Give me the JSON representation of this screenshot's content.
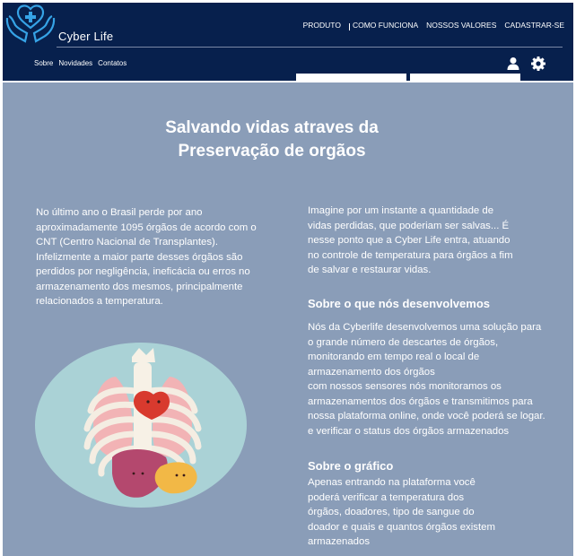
{
  "header": {
    "brand": "Cyber Life",
    "top_nav": [
      "PRODUTO",
      "COMO FUNCIONA",
      "NOSSOS VALORES",
      "CADASTRAR-SE"
    ],
    "sub_nav": [
      "Sobre",
      "Novidades",
      "Contatos"
    ],
    "icons": [
      "user-icon",
      "gear-icon"
    ]
  },
  "main": {
    "title_line1": "Salvando vidas atraves da",
    "title_line2": "Preservação de orgãos",
    "intro": [
      "No último ano o Brasil perde por ano",
      "aproximadamente 1095 órgãos de acordo com o",
      "CNT (Centro Nacional de Transplantes).",
      "Infelizmente a maior parte desses órgãos são",
      "perdidos por negligência, ineficácia ou erros no",
      "armazenamento dos mesmos, principalmente",
      "relacionados a temperatura."
    ],
    "imagine": [
      "Imagine por um instante a quantidade de",
      "vidas perdidas, que poderiam ser salvas... É",
      "nesse ponto que a Cyber Life entra, atuando",
      "no controle de temperatura para órgãos a fim",
      "de salvar e restaurar vidas."
    ],
    "section1_heading": "Sobre o que nós desenvolvemos",
    "section1_text": [
      "Nós da Cyberlife desenvolvemos uma solução para",
      "o grande número de descartes de órgãos,",
      "monitorando em tempo real o local de",
      "armazenamento dos órgãos",
      "com nossos sensores nós monitoramos os",
      "armazenamentos dos órgãos e transmitimos para",
      "nossa plataforma online, onde você poderá se logar.",
      "e verificar o status dos órgãos armazenados"
    ],
    "section2_heading": "Sobre o gráfico",
    "section2_text": [
      "Apenas entrando na plataforma você",
      "poderá verificar a temperatura dos",
      "órgãos, doadores, tipo de sangue do",
      "doador e quais e quantos órgãos existem",
      "armazenados"
    ]
  }
}
